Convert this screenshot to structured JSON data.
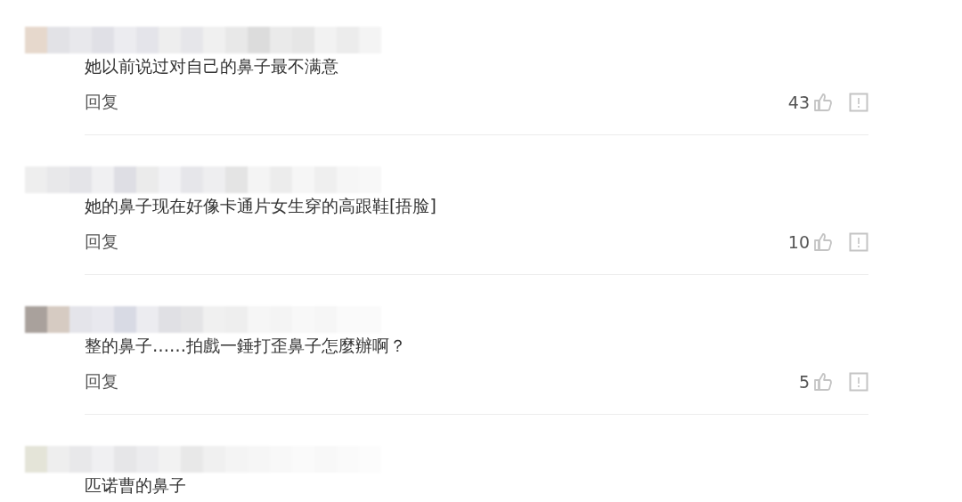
{
  "comments": [
    {
      "text": "她以前说过对自己的鼻子最不满意",
      "reply": "回复",
      "likes": "43"
    },
    {
      "text": "她的鼻子现在好像卡通片女生穿的高跟鞋[捂脸]",
      "reply": "回复",
      "likes": "10"
    },
    {
      "text": "整的鼻子……拍戲一錘打歪鼻子怎麼辦啊？",
      "reply": "回复",
      "likes": "5"
    },
    {
      "text": "匹诺曹的鼻子"
    }
  ]
}
